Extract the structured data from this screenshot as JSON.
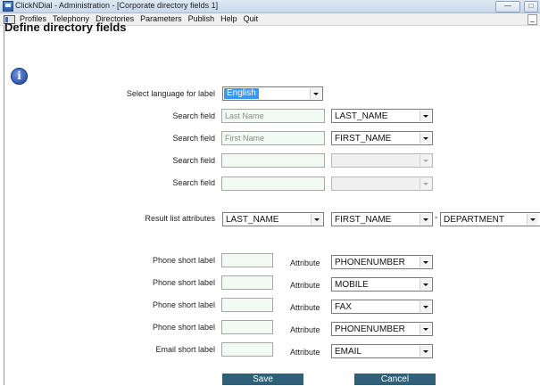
{
  "window": {
    "title": "ClickNDial - Administration - [Corporate directory fields 1]"
  },
  "menu": {
    "items": [
      "Profiles",
      "Telephony",
      "Directories",
      "Parameters",
      "Publish",
      "Help",
      "Quit"
    ]
  },
  "page": {
    "title": "Define directory fields"
  },
  "language": {
    "label": "Select language for label",
    "value": "English"
  },
  "search_fields": [
    {
      "label": "Search field",
      "placeholder": "Last Name",
      "attribute": "LAST_NAME"
    },
    {
      "label": "Search field",
      "placeholder": "First Name",
      "attribute": "FIRST_NAME"
    },
    {
      "label": "Search field",
      "placeholder": "",
      "attribute": ""
    },
    {
      "label": "Search field",
      "placeholder": "",
      "attribute": ""
    }
  ],
  "result_list": {
    "label": "Result list attributes",
    "values": [
      "LAST_NAME",
      "FIRST_NAME",
      "DEPARTMENT"
    ],
    "separator": "-"
  },
  "short_labels": [
    {
      "label": "Phone short label",
      "attr_label": "Attribute",
      "attribute": "PHONENUMBER"
    },
    {
      "label": "Phone short label",
      "attr_label": "Attribute",
      "attribute": "MOBILE"
    },
    {
      "label": "Phone short label",
      "attr_label": "Attribute",
      "attribute": "FAX"
    },
    {
      "label": "Phone short label",
      "attr_label": "Attribute",
      "attribute": "PHONENUMBER"
    },
    {
      "label": "Email short label",
      "attr_label": "Attribute",
      "attribute": "EMAIL"
    }
  ],
  "buttons": {
    "save": "Save",
    "cancel": "Cancel"
  },
  "icons": {
    "app": "app-window-icon",
    "info": "info-icon"
  },
  "colors": {
    "selection": "#3399ff",
    "button": "#2f607a",
    "input_bg": "#f1fbf3"
  }
}
